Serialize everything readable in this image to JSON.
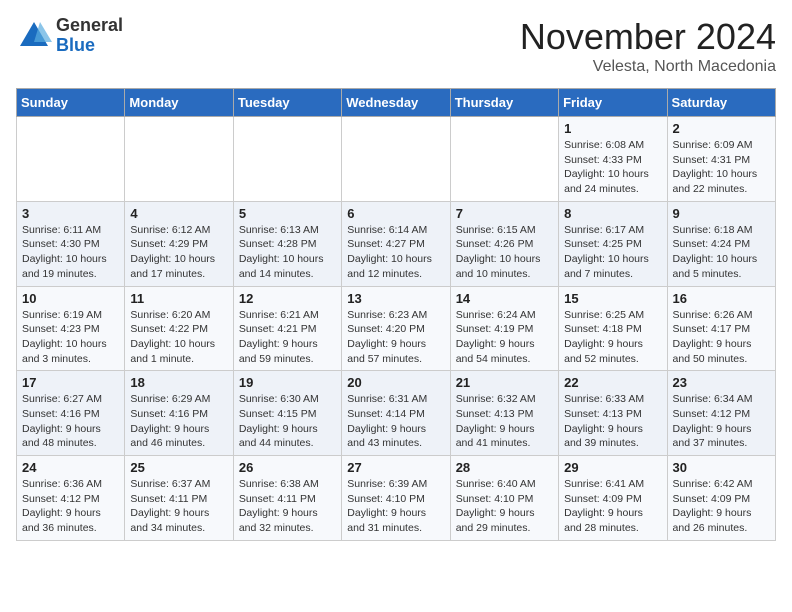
{
  "logo": {
    "general": "General",
    "blue": "Blue"
  },
  "title": {
    "month": "November 2024",
    "location": "Velesta, North Macedonia"
  },
  "weekdays": [
    "Sunday",
    "Monday",
    "Tuesday",
    "Wednesday",
    "Thursday",
    "Friday",
    "Saturday"
  ],
  "weeks": [
    [
      {
        "day": "",
        "info": ""
      },
      {
        "day": "",
        "info": ""
      },
      {
        "day": "",
        "info": ""
      },
      {
        "day": "",
        "info": ""
      },
      {
        "day": "",
        "info": ""
      },
      {
        "day": "1",
        "info": "Sunrise: 6:08 AM\nSunset: 4:33 PM\nDaylight: 10 hours\nand 24 minutes."
      },
      {
        "day": "2",
        "info": "Sunrise: 6:09 AM\nSunset: 4:31 PM\nDaylight: 10 hours\nand 22 minutes."
      }
    ],
    [
      {
        "day": "3",
        "info": "Sunrise: 6:11 AM\nSunset: 4:30 PM\nDaylight: 10 hours\nand 19 minutes."
      },
      {
        "day": "4",
        "info": "Sunrise: 6:12 AM\nSunset: 4:29 PM\nDaylight: 10 hours\nand 17 minutes."
      },
      {
        "day": "5",
        "info": "Sunrise: 6:13 AM\nSunset: 4:28 PM\nDaylight: 10 hours\nand 14 minutes."
      },
      {
        "day": "6",
        "info": "Sunrise: 6:14 AM\nSunset: 4:27 PM\nDaylight: 10 hours\nand 12 minutes."
      },
      {
        "day": "7",
        "info": "Sunrise: 6:15 AM\nSunset: 4:26 PM\nDaylight: 10 hours\nand 10 minutes."
      },
      {
        "day": "8",
        "info": "Sunrise: 6:17 AM\nSunset: 4:25 PM\nDaylight: 10 hours\nand 7 minutes."
      },
      {
        "day": "9",
        "info": "Sunrise: 6:18 AM\nSunset: 4:24 PM\nDaylight: 10 hours\nand 5 minutes."
      }
    ],
    [
      {
        "day": "10",
        "info": "Sunrise: 6:19 AM\nSunset: 4:23 PM\nDaylight: 10 hours\nand 3 minutes."
      },
      {
        "day": "11",
        "info": "Sunrise: 6:20 AM\nSunset: 4:22 PM\nDaylight: 10 hours\nand 1 minute."
      },
      {
        "day": "12",
        "info": "Sunrise: 6:21 AM\nSunset: 4:21 PM\nDaylight: 9 hours\nand 59 minutes."
      },
      {
        "day": "13",
        "info": "Sunrise: 6:23 AM\nSunset: 4:20 PM\nDaylight: 9 hours\nand 57 minutes."
      },
      {
        "day": "14",
        "info": "Sunrise: 6:24 AM\nSunset: 4:19 PM\nDaylight: 9 hours\nand 54 minutes."
      },
      {
        "day": "15",
        "info": "Sunrise: 6:25 AM\nSunset: 4:18 PM\nDaylight: 9 hours\nand 52 minutes."
      },
      {
        "day": "16",
        "info": "Sunrise: 6:26 AM\nSunset: 4:17 PM\nDaylight: 9 hours\nand 50 minutes."
      }
    ],
    [
      {
        "day": "17",
        "info": "Sunrise: 6:27 AM\nSunset: 4:16 PM\nDaylight: 9 hours\nand 48 minutes."
      },
      {
        "day": "18",
        "info": "Sunrise: 6:29 AM\nSunset: 4:16 PM\nDaylight: 9 hours\nand 46 minutes."
      },
      {
        "day": "19",
        "info": "Sunrise: 6:30 AM\nSunset: 4:15 PM\nDaylight: 9 hours\nand 44 minutes."
      },
      {
        "day": "20",
        "info": "Sunrise: 6:31 AM\nSunset: 4:14 PM\nDaylight: 9 hours\nand 43 minutes."
      },
      {
        "day": "21",
        "info": "Sunrise: 6:32 AM\nSunset: 4:13 PM\nDaylight: 9 hours\nand 41 minutes."
      },
      {
        "day": "22",
        "info": "Sunrise: 6:33 AM\nSunset: 4:13 PM\nDaylight: 9 hours\nand 39 minutes."
      },
      {
        "day": "23",
        "info": "Sunrise: 6:34 AM\nSunset: 4:12 PM\nDaylight: 9 hours\nand 37 minutes."
      }
    ],
    [
      {
        "day": "24",
        "info": "Sunrise: 6:36 AM\nSunset: 4:12 PM\nDaylight: 9 hours\nand 36 minutes."
      },
      {
        "day": "25",
        "info": "Sunrise: 6:37 AM\nSunset: 4:11 PM\nDaylight: 9 hours\nand 34 minutes."
      },
      {
        "day": "26",
        "info": "Sunrise: 6:38 AM\nSunset: 4:11 PM\nDaylight: 9 hours\nand 32 minutes."
      },
      {
        "day": "27",
        "info": "Sunrise: 6:39 AM\nSunset: 4:10 PM\nDaylight: 9 hours\nand 31 minutes."
      },
      {
        "day": "28",
        "info": "Sunrise: 6:40 AM\nSunset: 4:10 PM\nDaylight: 9 hours\nand 29 minutes."
      },
      {
        "day": "29",
        "info": "Sunrise: 6:41 AM\nSunset: 4:09 PM\nDaylight: 9 hours\nand 28 minutes."
      },
      {
        "day": "30",
        "info": "Sunrise: 6:42 AM\nSunset: 4:09 PM\nDaylight: 9 hours\nand 26 minutes."
      }
    ]
  ]
}
